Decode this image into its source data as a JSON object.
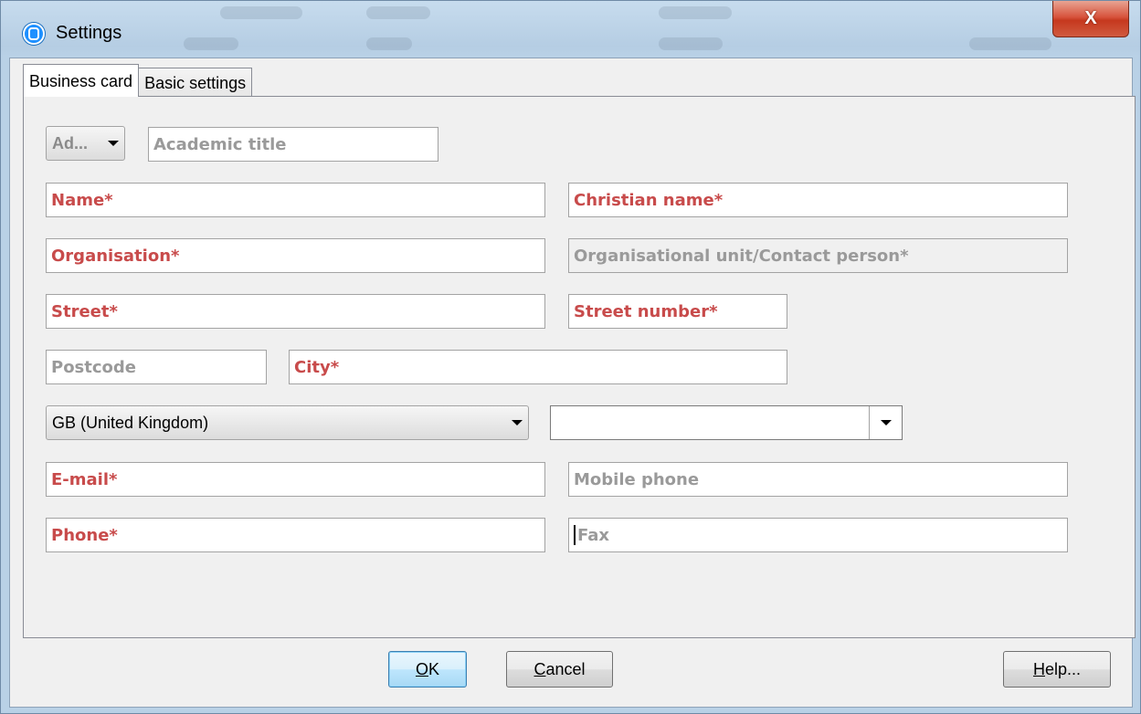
{
  "window": {
    "title": "Settings",
    "close_label": "X"
  },
  "tabs": [
    {
      "label": "Business card",
      "active": true
    },
    {
      "label": "Basic settings",
      "active": false
    }
  ],
  "form": {
    "salutation": {
      "value": "Ad..."
    },
    "academic_title": {
      "placeholder": "Academic title"
    },
    "name": {
      "placeholder": "Name*"
    },
    "christian_name": {
      "placeholder": "Christian name*"
    },
    "organisation": {
      "placeholder": "Organisation*"
    },
    "org_unit": {
      "placeholder": "Organisational unit/Contact person*"
    },
    "street": {
      "placeholder": "Street*"
    },
    "street_number": {
      "placeholder": "Street number*"
    },
    "postcode": {
      "placeholder": "Postcode"
    },
    "city": {
      "placeholder": "City*"
    },
    "country": {
      "value": "GB (United Kingdom)"
    },
    "region": {
      "value": ""
    },
    "email": {
      "placeholder": "E-mail*"
    },
    "mobile": {
      "placeholder": "Mobile phone"
    },
    "phone": {
      "placeholder": "Phone*"
    },
    "fax": {
      "placeholder": "Fax"
    }
  },
  "buttons": {
    "ok": {
      "mnemonic": "O",
      "rest": "K"
    },
    "cancel": {
      "mnemonic": "C",
      "rest": "ancel"
    },
    "help": {
      "mnemonic": "H",
      "rest": "elp..."
    }
  },
  "colors": {
    "required_text": "#c84b4b",
    "optional_text": "#9a9a9a",
    "dialog_bg": "#f0f0f0",
    "close_button": "#c6381e"
  }
}
